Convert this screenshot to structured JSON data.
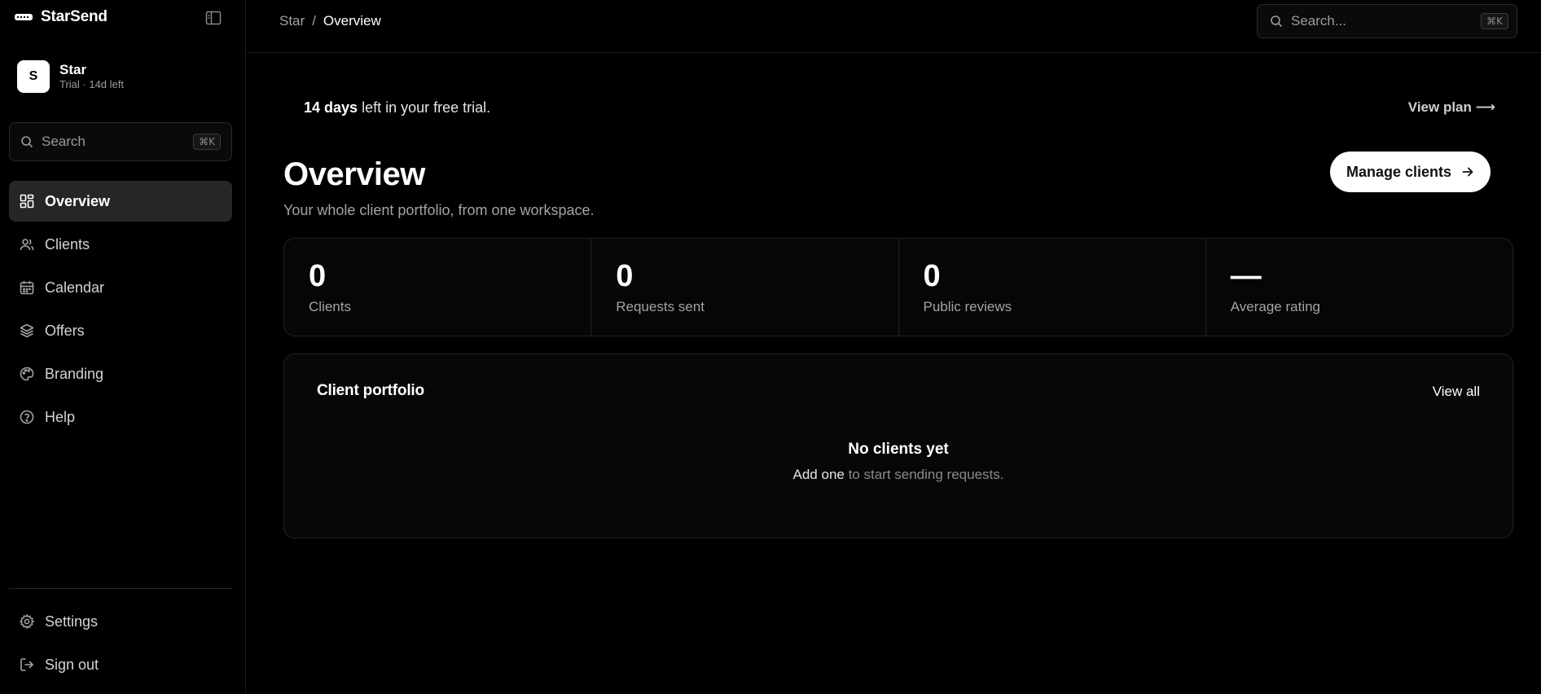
{
  "brand": {
    "name": "StarSend"
  },
  "workspace": {
    "initial": "S",
    "name": "Star",
    "subtitle": "Trial · 14d left"
  },
  "sidebar_search": {
    "placeholder": "Search",
    "shortcut": "⌘K"
  },
  "nav": {
    "items": [
      {
        "label": "Overview",
        "icon": "grid-icon",
        "active": true
      },
      {
        "label": "Clients",
        "icon": "users-icon",
        "active": false
      },
      {
        "label": "Calendar",
        "icon": "calendar-icon",
        "active": false
      },
      {
        "label": "Offers",
        "icon": "layers-icon",
        "active": false
      },
      {
        "label": "Branding",
        "icon": "palette-icon",
        "active": false
      },
      {
        "label": "Help",
        "icon": "help-circle-icon",
        "active": false
      }
    ],
    "bottom": [
      {
        "label": "Settings",
        "icon": "gear-icon"
      },
      {
        "label": "Sign out",
        "icon": "sign-out-icon"
      }
    ]
  },
  "breadcrumb": {
    "root": "Star",
    "separator": "/",
    "current": "Overview"
  },
  "top_search": {
    "placeholder": "Search...",
    "shortcut": "⌘K"
  },
  "trial_banner": {
    "days": "14 days",
    "rest": " left in your free trial.",
    "link": "View plan ⟶"
  },
  "header": {
    "title": "Overview",
    "subtitle": "Your whole client portfolio, from one workspace.",
    "button_label": "Manage clients"
  },
  "stats": [
    {
      "value": "0",
      "label": "Clients"
    },
    {
      "value": "0",
      "label": "Requests sent"
    },
    {
      "value": "0",
      "label": "Public reviews"
    },
    {
      "value": "—",
      "label": "Average rating"
    }
  ],
  "portfolio": {
    "title": "Client portfolio",
    "view_all": "View all",
    "empty_title": "No clients yet",
    "empty_link": "Add one",
    "empty_rest": " to start sending requests."
  },
  "colors": {
    "background": "#000000",
    "accent": "#ffffff",
    "muted": "#a3a3a3",
    "border": "#222222"
  }
}
